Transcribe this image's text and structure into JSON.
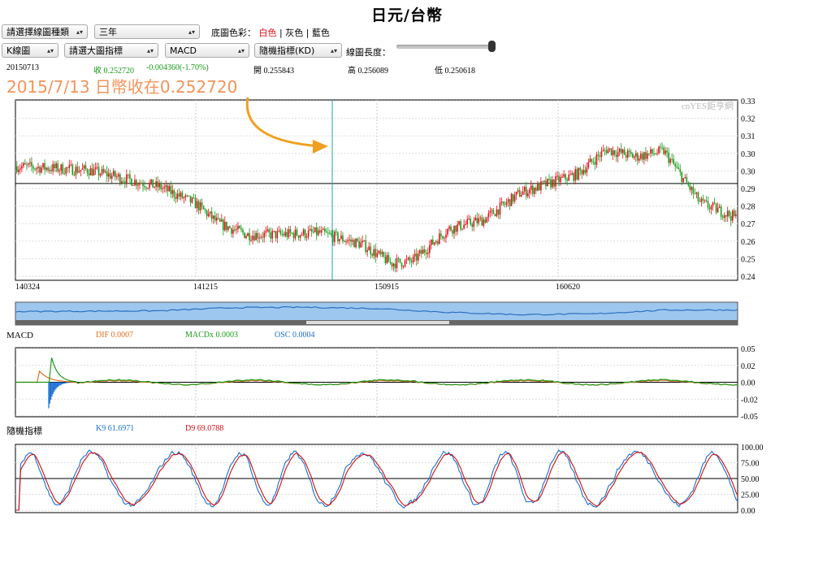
{
  "header": {
    "title": "日元/台幣"
  },
  "controls": {
    "chart_type_select": "請選擇線圖種類",
    "period_select": "三年",
    "bg_color_label": "底圖色彩：",
    "bg_colors": [
      "白色",
      "灰色",
      "藍色"
    ],
    "bg_separator": "|",
    "main_type_select": "K線圖",
    "main_indicator_select": "請選大圖指標",
    "macd_select": "MACD",
    "kd_select": "隨機指標(KD)",
    "length_label": "線圖長度：",
    "length_value": 0.95
  },
  "quote": {
    "date": "20150713",
    "close": "收 0.252720",
    "change": "-0.004360(-1.70%)",
    "open": "開 0.255843",
    "high": "高 0.256089",
    "low": "低 0.250618"
  },
  "annotation": {
    "text": "2015/7/13 日幣收在0.252720"
  },
  "colors": {
    "up": "#e0101a",
    "down": "#1a9a1a",
    "annotation": "#f5935a",
    "arrow": "#f0a020",
    "cursor": "#2aa0a0"
  },
  "chart_data": [
    {
      "type": "candlestick",
      "watermark": "cnYES鉅亨網",
      "x_ticks": [
        "140324",
        "141215",
        "150915",
        "160620"
      ],
      "y_ticks": [
        "0.33",
        "0.32",
        "0.31",
        "0.30",
        "0.30",
        "0.29",
        "0.28",
        "0.27",
        "0.26",
        "0.25",
        "0.24"
      ],
      "ylim": [
        0.238,
        0.333
      ],
      "reference_line": 0.289,
      "cursor_date": "20150713",
      "price_path_x": [
        0,
        5,
        10,
        20,
        25,
        28,
        32,
        36,
        42,
        48,
        52,
        55,
        60,
        65,
        70,
        78,
        82,
        86,
        90,
        95,
        100
      ],
      "price_path_y": [
        0.298,
        0.297,
        0.296,
        0.287,
        0.278,
        0.268,
        0.262,
        0.262,
        0.263,
        0.257,
        0.247,
        0.248,
        0.265,
        0.27,
        0.284,
        0.294,
        0.307,
        0.303,
        0.306,
        0.279,
        0.271
      ]
    },
    {
      "type": "area",
      "name": "navigator",
      "window_range": [
        0.4,
        0.6
      ],
      "path_x": [
        0,
        20,
        30,
        40,
        50,
        60,
        70,
        80,
        90,
        100
      ],
      "path_y": [
        0.5,
        0.55,
        0.75,
        0.78,
        0.7,
        0.45,
        0.3,
        0.35,
        0.6,
        0.6
      ]
    },
    {
      "type": "line",
      "title": "MACD",
      "legend": [
        "DIF 0.0007",
        "MACDx 0.0003",
        "OSC 0.0004"
      ],
      "y_ticks": [
        "0.05",
        "0.02",
        "0.00",
        "-0.02",
        "-0.05"
      ],
      "ylim": [
        -0.05,
        0.05
      ]
    },
    {
      "type": "line",
      "title": "隨機指標",
      "legend": [
        "K9 61.6971",
        "D9 69.0788"
      ],
      "y_ticks": [
        "100.00",
        "75.00",
        "50.00",
        "25.00",
        "0.00"
      ],
      "ylim": [
        0,
        100
      ],
      "reference_line": 50
    }
  ]
}
